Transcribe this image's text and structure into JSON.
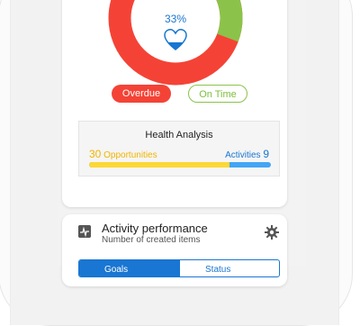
{
  "donut": {
    "percent_label": "33%",
    "segments": [
      {
        "name": "overdue",
        "fraction": 0.76,
        "color": "#f44336"
      },
      {
        "name": "on_time",
        "fraction": 0.24,
        "color": "#8bc34a"
      }
    ],
    "icon": "heart-icon",
    "accent": "#1976d2"
  },
  "filters": {
    "overdue_label": "Overdue",
    "on_time_label": "On Time"
  },
  "analysis": {
    "title": "Health Analysis",
    "opportunities_count": "30",
    "opportunities_label": "Opportunities",
    "activities_label": "Activities",
    "activities_count": "9",
    "opportunities_fraction": 0.77,
    "opportunities_color": "#fdd835",
    "activities_color": "#42a5f5"
  },
  "activity_performance": {
    "title": "Activity performance",
    "subtitle": "Number of created items",
    "icon": "activity-pulse-icon",
    "settings_icon": "gear-icon",
    "tab_1_label": "Goals",
    "tab_2_label": "Status"
  }
}
